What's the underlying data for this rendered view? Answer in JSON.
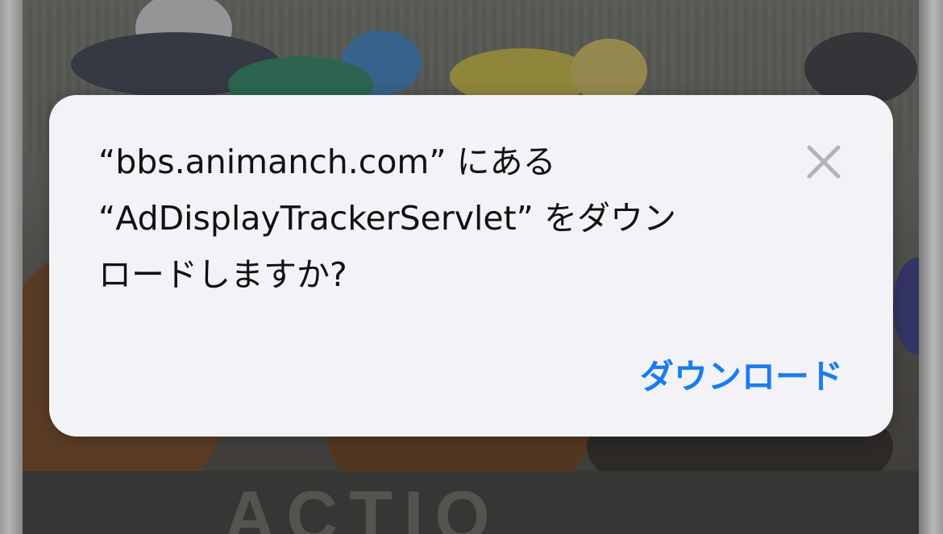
{
  "dialog": {
    "message_line1": "“bbs.animanch.com” にある",
    "message_line2": "“AdDisplayTrackerServlet” をダウン",
    "message_line3": "ロードしますか?",
    "download_label": "ダウンロード",
    "close_icon": "close-icon"
  },
  "colors": {
    "dialog_background": "#f2f2f7",
    "accent": "#1a7cf0",
    "close_icon": "#b4b4b8"
  }
}
